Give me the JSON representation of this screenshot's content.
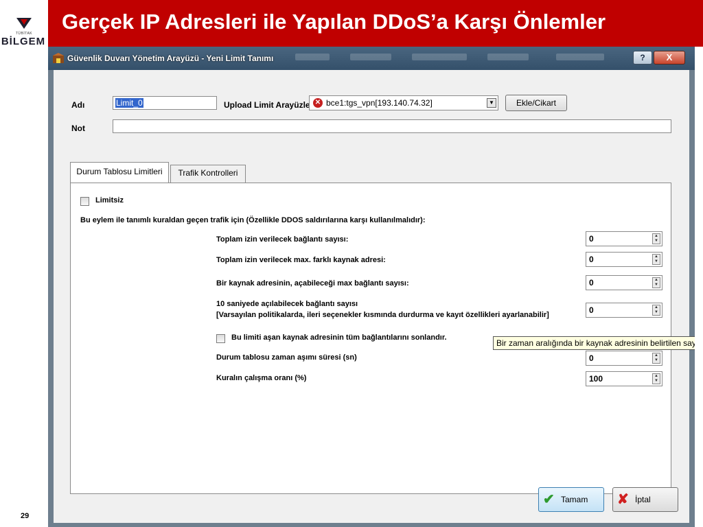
{
  "slide": {
    "title": "Gerçek IP Adresleri ile Yapılan DDoS’a Karşı Önlemler",
    "page_number": "29",
    "logo_text": "BİLGEM",
    "logo_small": "TÜBİTAK"
  },
  "window": {
    "title": "Güvenlik Duvarı Yönetim Arayüzü - Yeni Limit Tanımı",
    "help_label": "?",
    "close_label": "X"
  },
  "form": {
    "name_label": "Adı",
    "name_value": "Limit_0",
    "upload_label": "Upload Limit Arayüzleri",
    "upload_value": "bce1:tgs_vpn[193.140.74.32]",
    "add_remove_label": "Ekle/Cikart",
    "note_label": "Not",
    "note_value": ""
  },
  "tabs": [
    {
      "label": "Durum Tablosu Limitleri",
      "active": true
    },
    {
      "label": "Trafik Kontrolleri",
      "active": false
    }
  ],
  "panel": {
    "unlimited_label": "Limitsiz",
    "description": "Bu eylem ile tanımlı kuraldan geçen trafik için (Özellikle DDOS saldırılarına karşı kullanılmalıdır):",
    "fields": [
      {
        "label": "Toplam izin verilecek bağlantı sayısı:",
        "value": "0"
      },
      {
        "label": "Toplam izin verilecek max. farklı kaynak adresi:",
        "value": "0"
      },
      {
        "label": "Bir kaynak adresinin, açabileceği max bağlantı sayısı:",
        "value": "0"
      },
      {
        "label": "10 saniyede açılabilecek bağlantı sayısı",
        "sublabel": "[Varsayılan politikalarda, ileri seçenekler kısmında durdurma ve kayıt özellikleri ayarlanabilir]",
        "value": "0"
      }
    ],
    "terminate_label": "Bu limiti aşan kaynak adresinin tüm bağlantılarını sonlandır.",
    "tooltip": "Bir zaman aralığında bir kaynak adresinin belirtilen sayıdan",
    "timeout_label": "Durum tablosu zaman aşımı süresi (sn)",
    "timeout_value": "0",
    "ratio_label": "Kuralın çalışma oranı (%)",
    "ratio_value": "100"
  },
  "buttons": {
    "ok": "Tamam",
    "cancel": "İptal"
  },
  "colors": {
    "title_bar": "#c00000",
    "window_frame": "#34506a"
  }
}
